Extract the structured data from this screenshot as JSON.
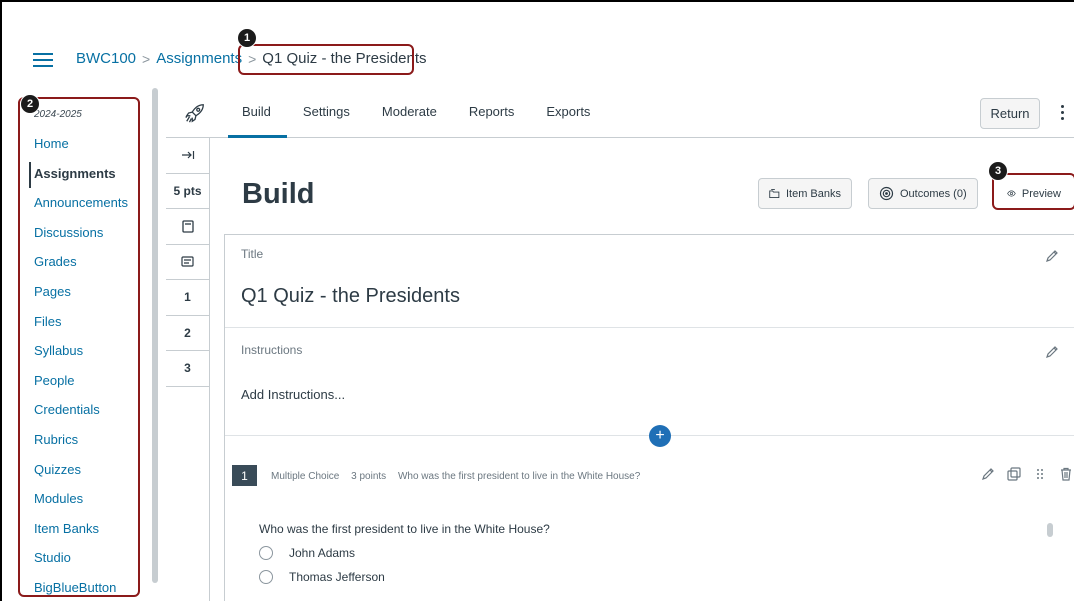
{
  "breadcrumb": {
    "course": "BWC100",
    "section": "Assignments",
    "current": "Q1 Quiz - the Presidents"
  },
  "callouts": [
    "1",
    "2",
    "3"
  ],
  "course_nav": {
    "term": "2024-2025",
    "items": [
      {
        "label": "Home",
        "active": false
      },
      {
        "label": "Assignments",
        "active": true
      },
      {
        "label": "Announcements",
        "active": false
      },
      {
        "label": "Discussions",
        "active": false
      },
      {
        "label": "Grades",
        "active": false
      },
      {
        "label": "Pages",
        "active": false
      },
      {
        "label": "Files",
        "active": false
      },
      {
        "label": "Syllabus",
        "active": false
      },
      {
        "label": "People",
        "active": false
      },
      {
        "label": "Credentials",
        "active": false
      },
      {
        "label": "Rubrics",
        "active": false
      },
      {
        "label": "Quizzes",
        "active": false
      },
      {
        "label": "Modules",
        "active": false
      },
      {
        "label": "Item Banks",
        "active": false
      },
      {
        "label": "Studio",
        "active": false
      },
      {
        "label": "BigBlueButton",
        "active": false
      }
    ]
  },
  "toolbar": {
    "icon": "rocket-icon",
    "tabs": [
      "Build",
      "Settings",
      "Moderate",
      "Reports",
      "Exports"
    ],
    "active_tab": "Build",
    "return_label": "Return"
  },
  "rail": {
    "expand_icon": "expand-right-icon",
    "points": "5 pts",
    "items": [
      "1",
      "2",
      "3"
    ]
  },
  "build": {
    "heading": "Build",
    "item_banks_label": "Item Banks",
    "outcomes_label": "Outcomes (0)",
    "preview_label": "Preview",
    "title_label": "Title",
    "quiz_title": "Q1 Quiz - the Presidents",
    "instructions_label": "Instructions",
    "add_instructions": "Add Instructions..."
  },
  "question": {
    "number": "1",
    "type": "Multiple Choice",
    "points": "3 points",
    "summary": "Who was the first president to live in the White House?",
    "text": "Who was the first president to live in the White House?",
    "options": [
      "John Adams",
      "Thomas Jefferson"
    ]
  },
  "colors": {
    "link": "#0770a3",
    "highlight": "#8b1a1a",
    "text": "#2d3b45",
    "add_button": "#1f6fb6"
  }
}
